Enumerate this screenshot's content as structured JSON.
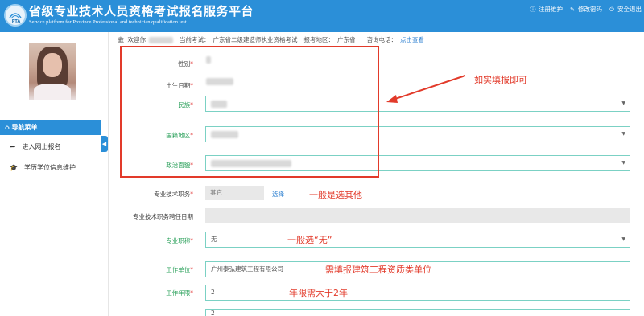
{
  "header": {
    "title": "省级专业技术人员资格考试报名服务平台",
    "subtitle": "Service platform for Province Professional and technician qualification test",
    "logo_text": "PTA",
    "links": [
      {
        "icon": "info-icon",
        "label": "注册维护"
      },
      {
        "icon": "edit-icon",
        "label": "修改密码"
      },
      {
        "icon": "power-icon",
        "label": "安全退出"
      }
    ]
  },
  "sidebar": {
    "menu_title": "导航菜单",
    "items": [
      {
        "icon": "share-icon",
        "label": "进入网上报名"
      },
      {
        "icon": "graduation-cap-icon",
        "label": "学历学位信息维护"
      }
    ]
  },
  "info_bar": {
    "welcome": "欢迎你",
    "current_exam_label": "当前考试：",
    "current_exam": "广东省二级建造师执业资格考试",
    "region_label": "报考地区：",
    "region": "广东省",
    "phone_label": "咨询电话：",
    "phone_link": "点击查看"
  },
  "form": {
    "gender_label": "性别",
    "birth_label": "出生日期",
    "ethnicity_label": "民族",
    "nationality_label": "国籍地区",
    "political_label": "政治面貌",
    "tech_title_label": "专业技术职务",
    "tech_title_value": "其它",
    "tech_title_select": "选择",
    "tech_date_label": "专业技术职务聘任日期",
    "prof_title_label": "专业职称",
    "prof_title_value": "无",
    "work_unit_label": "工作单位",
    "work_unit_value": "广州泰弘建筑工程有限公司",
    "work_years_label": "工作年限",
    "work_years_value": "2",
    "next_value": "2"
  },
  "annotations": {
    "fill_truthfully": "如实填报即可",
    "choose_other": "一般是选其他",
    "choose_none": "一般选“无”",
    "fill_company": "需填报建筑工程资质类单位",
    "years_requirement": "年限需大于2年"
  },
  "colors": {
    "primary": "#2b8fd8",
    "annotation": "#e23a2a",
    "field_border": "#7bd1c4",
    "label_green": "#2aa05a"
  }
}
